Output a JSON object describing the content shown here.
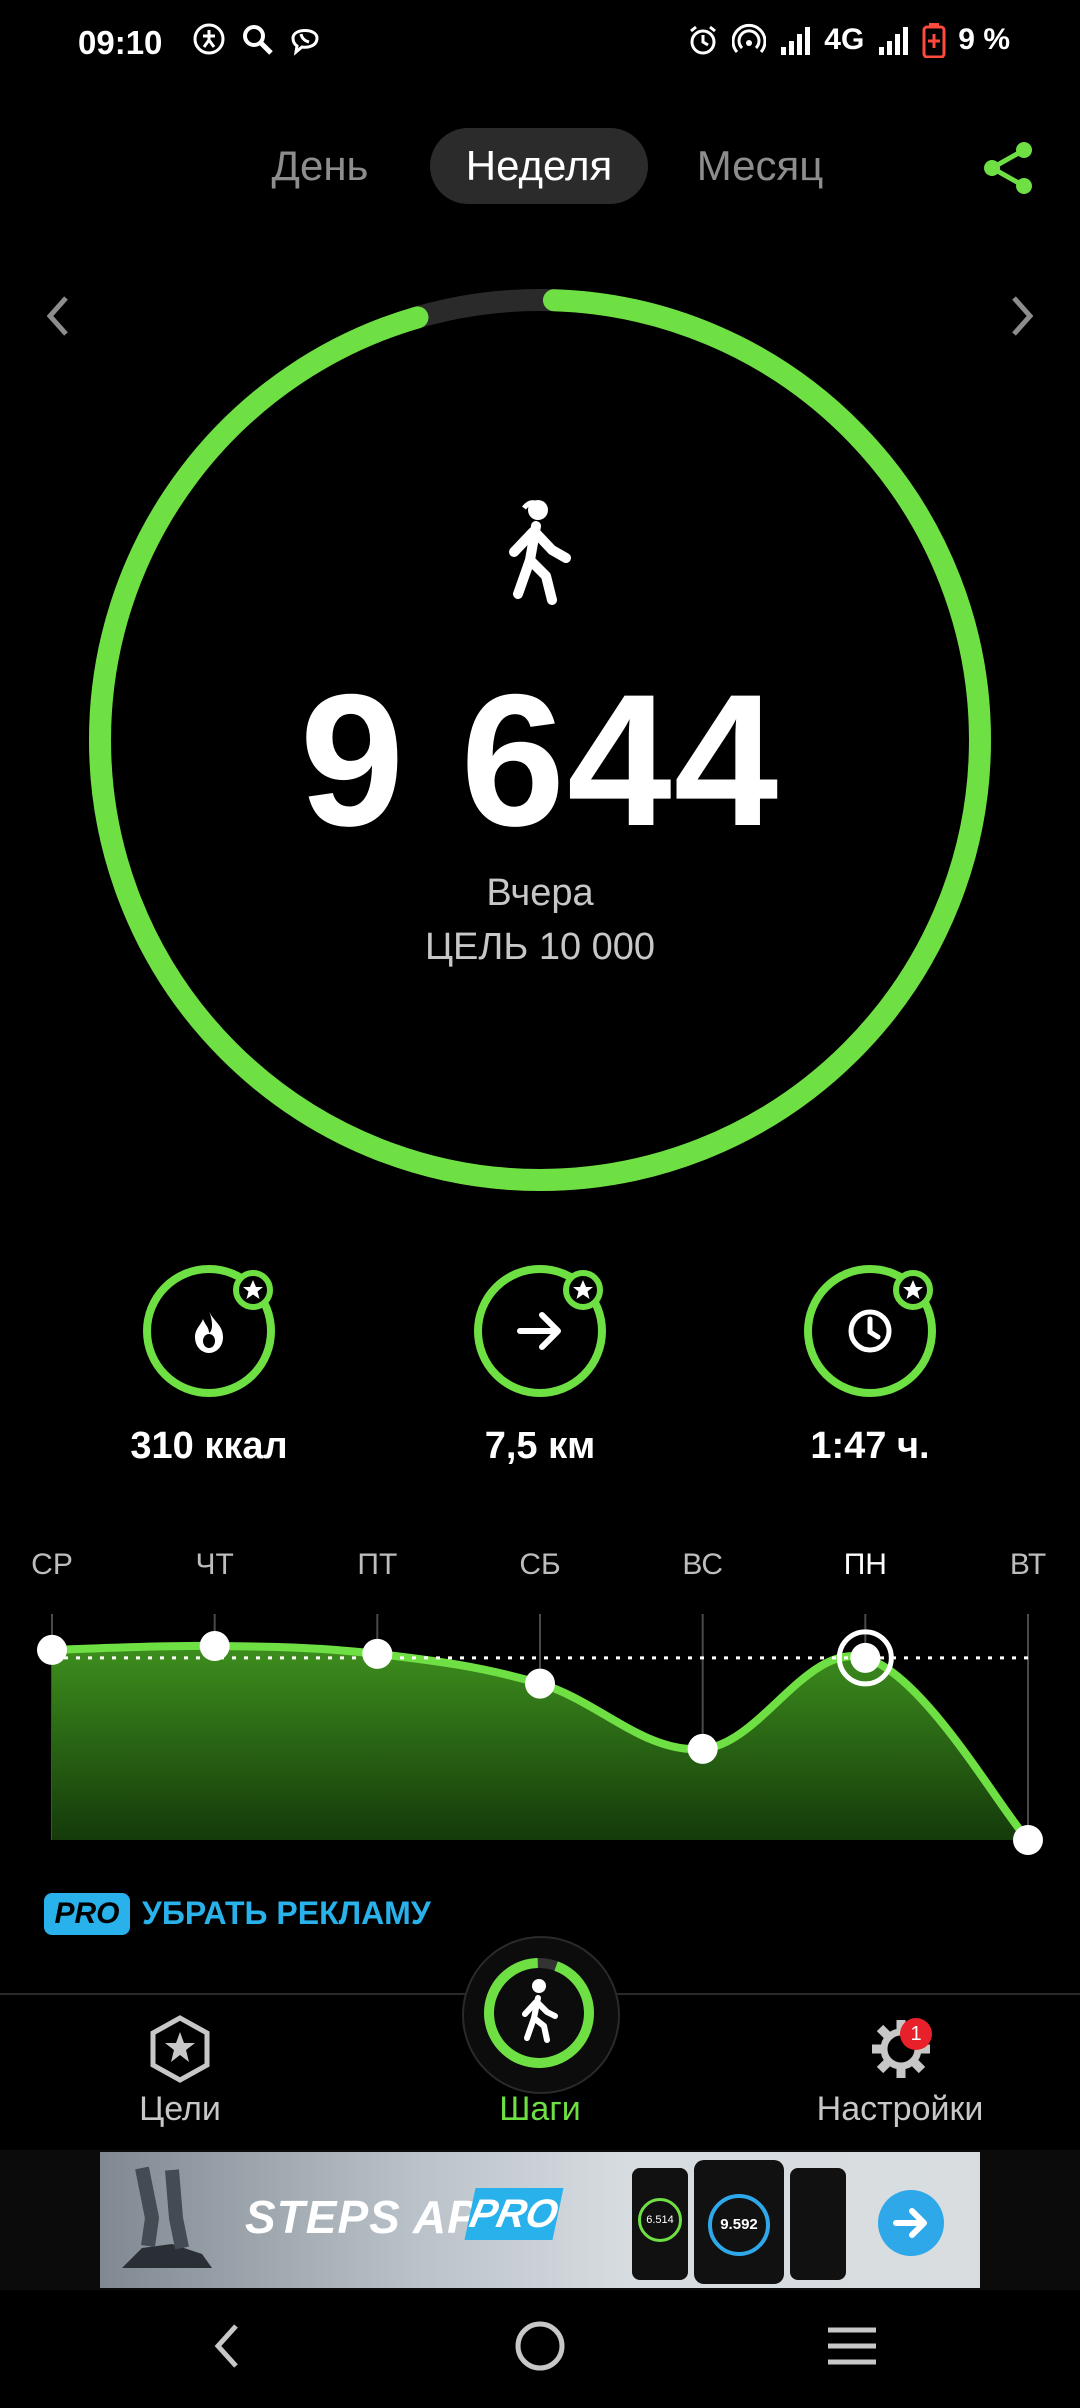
{
  "status_bar": {
    "time": "09:10",
    "network": "4G",
    "battery": "9 %"
  },
  "tabs": [
    {
      "label": "День"
    },
    {
      "label": "Неделя"
    },
    {
      "label": "Месяц"
    }
  ],
  "summary": {
    "steps": "9 644",
    "day": "Вчера",
    "goal": "ЦЕЛЬ 10 000",
    "progress": 0.9644
  },
  "stats": [
    {
      "icon": "flame-icon",
      "value": "310 ккал"
    },
    {
      "icon": "arrow-right-icon",
      "value": "7,5 км"
    },
    {
      "icon": "clock-icon",
      "value": "1:47 ч."
    }
  ],
  "chart_data": {
    "type": "area",
    "categories": [
      "СР",
      "ЧТ",
      "ПТ",
      "СБ",
      "ВС",
      "ПН",
      "ВТ"
    ],
    "selected": "ПН",
    "relative_values": [
      0.96,
      0.98,
      0.94,
      0.79,
      0.46,
      0.92,
      0.0
    ],
    "goal_line": 0.92,
    "color": "#6fe043"
  },
  "promo": {
    "badge": "PRO",
    "text": "УБРАТЬ РЕКЛАМУ"
  },
  "bottom_nav": [
    {
      "label": "Цели",
      "icon": "star-icon"
    },
    {
      "label": "Шаги",
      "icon": "walk-icon",
      "active": true
    },
    {
      "label": "Настройки",
      "icon": "gear-icon",
      "badge": "1"
    }
  ],
  "ad": {
    "brand": "STEPS APP",
    "brand_pro": "PRO",
    "phone_reading_1": "6.514",
    "phone_reading_2": "9.592"
  },
  "colors": {
    "accent": "#6fe043",
    "pro_blue": "#28b1ea",
    "track": "#2a2a2a"
  }
}
